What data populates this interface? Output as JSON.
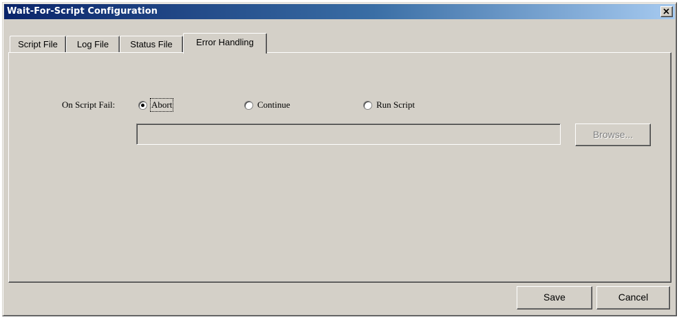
{
  "window": {
    "title": "Wait-For-Script Configuration",
    "close_icon": "close-icon"
  },
  "tabs": [
    {
      "label": "Script File",
      "active": false
    },
    {
      "label": "Log File",
      "active": false
    },
    {
      "label": "Status File",
      "active": false
    },
    {
      "label": "Error Handling",
      "active": true
    }
  ],
  "error_handling": {
    "on_fail_label": "On Script Fail:",
    "options": [
      {
        "label": "Abort",
        "selected": true
      },
      {
        "label": "Continue",
        "selected": false
      },
      {
        "label": "Run Script",
        "selected": false
      }
    ],
    "script_path_value": "",
    "browse_label": "Browse...",
    "browse_enabled": false
  },
  "footer": {
    "save_label": "Save",
    "cancel_label": "Cancel"
  },
  "colors": {
    "face": "#d4d0c8",
    "titlebar_start": "#0a246a",
    "titlebar_end": "#a6caf0"
  }
}
